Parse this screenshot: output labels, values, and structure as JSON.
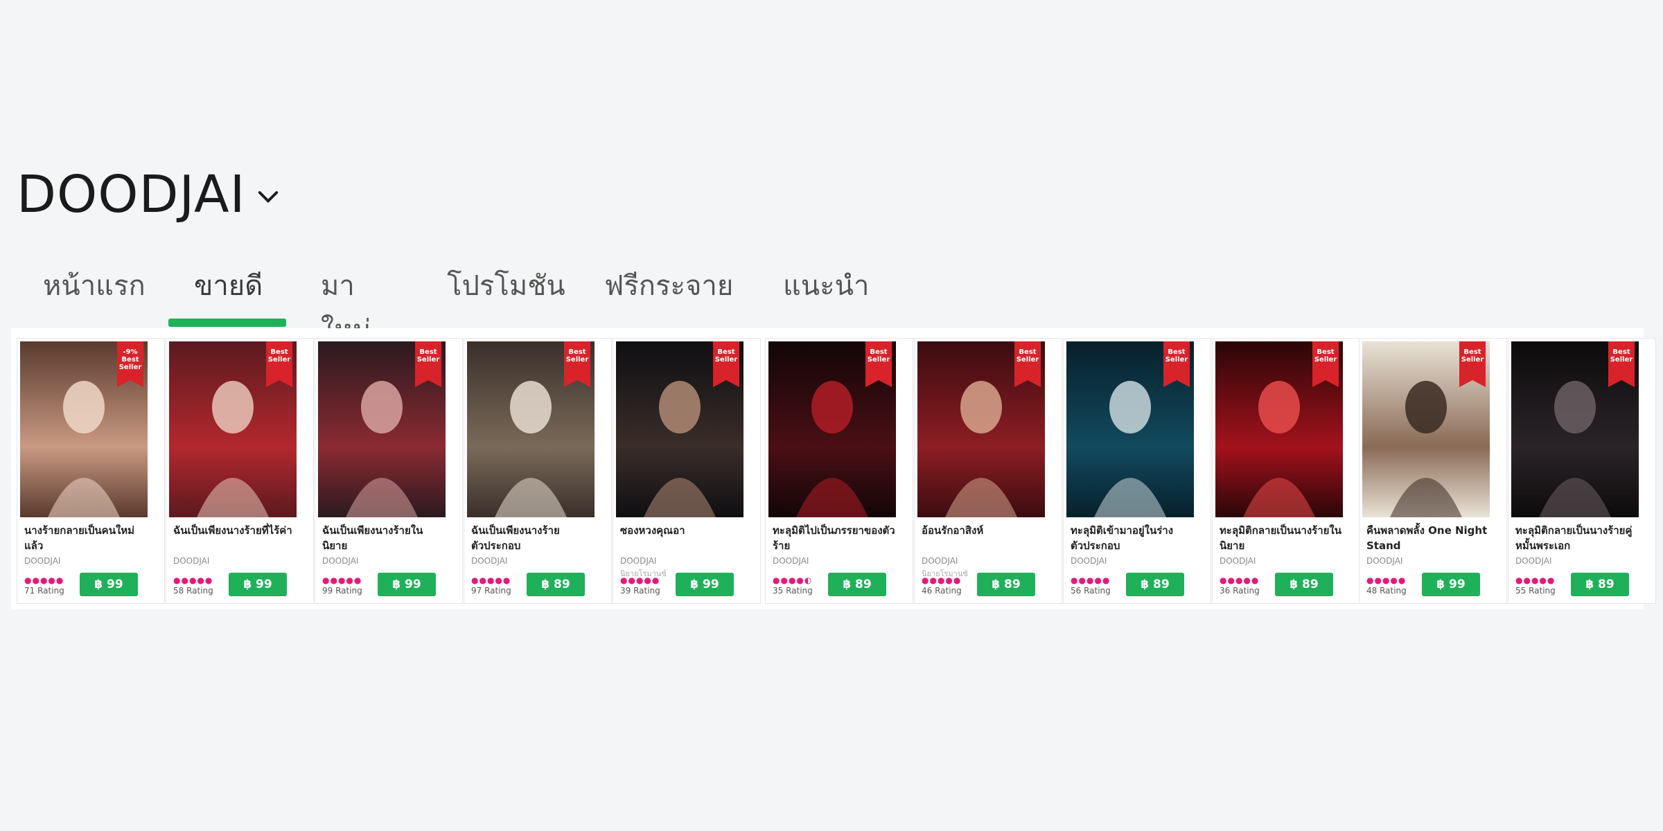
{
  "store": {
    "title": "DOODJAI"
  },
  "tabs": [
    {
      "label": "หน้าแรก"
    },
    {
      "label": "ขายดี"
    },
    {
      "label": "มาใหม่"
    },
    {
      "label": "โปรโมชัน"
    },
    {
      "label": "ฟรีกระจาย"
    },
    {
      "label": "แนะนำ"
    }
  ],
  "active_tab": "ขายดี",
  "colors": {
    "accent": "#1fb05a",
    "badge": "#d8232a",
    "stars": "#e5197a"
  },
  "books": [
    {
      "title": "นางร้ายกลายเป็นคนใหม่แล้ว",
      "author": "DOODJAI",
      "sub": "",
      "stars": "●●●●●",
      "rating": "71 Rating",
      "price": "฿ 99",
      "badge_top": "-9%",
      "badge": "Best Seller"
    },
    {
      "title": "ฉันเป็นเพียงนางร้ายที่ไร้ค่า",
      "author": "DOODJAI",
      "sub": "",
      "stars": "●●●●●",
      "rating": "58 Rating",
      "price": "฿ 99",
      "badge_top": "",
      "badge": "Best Seller"
    },
    {
      "title": "ฉันเป็นเพียงนางร้ายในนิยาย",
      "author": "DOODJAI",
      "sub": "",
      "stars": "●●●●●",
      "rating": "99 Rating",
      "price": "฿ 99",
      "badge_top": "",
      "badge": "Best Seller"
    },
    {
      "title": "ฉันเป็นเพียงนางร้ายตัวประกอบ",
      "author": "DOODJAI",
      "sub": "",
      "stars": "●●●●●",
      "rating": "97 Rating",
      "price": "฿ 89",
      "badge_top": "",
      "badge": "Best Seller"
    },
    {
      "title": "ซองหวงคุณอา",
      "author": "DOODJAI",
      "sub": "นิยายโรมานซ์",
      "stars": "●●●●●",
      "rating": "39 Rating",
      "price": "฿ 99",
      "badge_top": "",
      "badge": "Best Seller"
    },
    {
      "title": "ทะลุมิติไปเป็นภรรยาของตัวร้าย",
      "author": "DOODJAI",
      "sub": "",
      "stars": "●●●●◐",
      "rating": "35 Rating",
      "price": "฿ 89",
      "badge_top": "",
      "badge": "Best Seller"
    },
    {
      "title": "อ้อนรักอาสิงห์",
      "author": "DOODJAI",
      "sub": "นิยายโรมานซ์",
      "stars": "●●●●●",
      "rating": "46 Rating",
      "price": "฿ 89",
      "badge_top": "",
      "badge": "Best Seller"
    },
    {
      "title": "ทะลุมิติเข้ามาอยู่ในร่างตัวประกอบ",
      "author": "DOODJAI",
      "sub": "",
      "stars": "●●●●●",
      "rating": "56 Rating",
      "price": "฿ 89",
      "badge_top": "",
      "badge": "Best Seller"
    },
    {
      "title": "ทะลุมิติกลายเป็นนางร้ายในนิยาย",
      "author": "DOODJAI",
      "sub": "",
      "stars": "●●●●●",
      "rating": "36 Rating",
      "price": "฿ 89",
      "badge_top": "",
      "badge": "Best Seller"
    },
    {
      "title": "คืนพลาดพลั้ง One Night Stand",
      "author": "DOODJAI",
      "sub": "",
      "stars": "●●●●●",
      "rating": "48 Rating",
      "price": "฿ 99",
      "badge_top": "",
      "badge": "Best Seller"
    },
    {
      "title": "ทะลุมิติกลายเป็นนางร้ายคู่หมั้นพระเอก",
      "author": "DOODJAI",
      "sub": "",
      "stars": "●●●●●",
      "rating": "55 Rating",
      "price": "฿ 89",
      "badge_top": "",
      "badge": "Best Seller"
    }
  ]
}
